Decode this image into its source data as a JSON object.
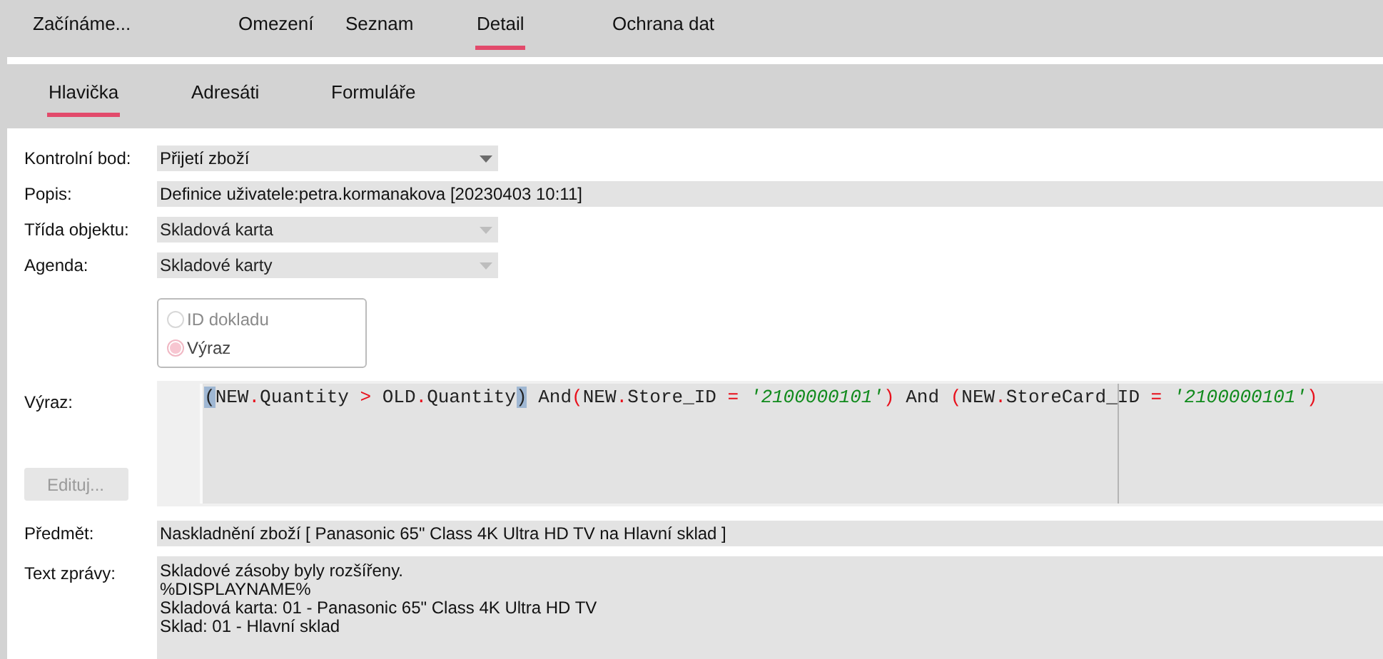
{
  "main_tabs": [
    {
      "label": "Začínáme...",
      "selected": false
    },
    {
      "label": "Omezení",
      "selected": false
    },
    {
      "label": "Seznam",
      "selected": false
    },
    {
      "label": "Detail",
      "selected": true
    },
    {
      "label": "Ochrana dat",
      "selected": false
    }
  ],
  "sub_tabs": [
    {
      "label": "Hlavička",
      "selected": true
    },
    {
      "label": "Adresáti",
      "selected": false
    },
    {
      "label": "Formuláře",
      "selected": false
    }
  ],
  "fields": [
    {
      "kind": "dropdown",
      "label": "Kontrolní bod:",
      "value": "Přijetí zboží",
      "disabled": false
    },
    {
      "kind": "text",
      "label": "Popis:",
      "value": "Definice uživatele:petra.kormanakova [20230403 10:11]"
    },
    {
      "kind": "dropdown",
      "label": "Třída objektu:",
      "value": "Skladová karta",
      "disabled": true
    },
    {
      "kind": "dropdown",
      "label": "Agenda:",
      "value": "Skladové karty",
      "disabled": true
    }
  ],
  "radios": [
    {
      "label": "ID dokladu",
      "selected": false
    },
    {
      "label": "Výraz",
      "selected": true
    }
  ],
  "expression": {
    "label": "Výraz:",
    "tokens": [
      {
        "kind": "match",
        "text": "("
      },
      {
        "kind": "plain",
        "text": "NEW"
      },
      {
        "kind": "op",
        "text": "."
      },
      {
        "kind": "plain",
        "text": "Quantity"
      },
      {
        "kind": "op",
        "text": " > "
      },
      {
        "kind": "plain",
        "text": "OLD"
      },
      {
        "kind": "op",
        "text": "."
      },
      {
        "kind": "plain",
        "text": "Quantity"
      },
      {
        "kind": "match",
        "text": ")"
      },
      {
        "kind": "plain",
        "text": " And"
      },
      {
        "kind": "op",
        "text": "("
      },
      {
        "kind": "plain",
        "text": "NEW"
      },
      {
        "kind": "op",
        "text": "."
      },
      {
        "kind": "plain",
        "text": "Store_ID"
      },
      {
        "kind": "op",
        "text": " = "
      },
      {
        "kind": "string",
        "text": "'2100000101'"
      },
      {
        "kind": "op",
        "text": ")"
      },
      {
        "kind": "plain",
        "text": " And "
      },
      {
        "kind": "op",
        "text": "("
      },
      {
        "kind": "plain",
        "text": "NEW"
      },
      {
        "kind": "op",
        "text": "."
      },
      {
        "kind": "plain",
        "text": "StoreCard_ID"
      },
      {
        "kind": "op",
        "text": " = "
      },
      {
        "kind": "string",
        "text": "'2100000101'"
      },
      {
        "kind": "op",
        "text": ")"
      }
    ],
    "edit_button": {
      "label": "Edituj...",
      "disabled": true
    }
  },
  "subject": {
    "label": "Předmět:",
    "value": "Naskladnění zboží [ Panasonic 65\" Class 4K Ultra HD TV na Hlavní sklad ]"
  },
  "message": {
    "label": "Text zprávy:",
    "lines": [
      "Skladové zásoby byly rozšířeny.",
      "%DISPLAYNAME%",
      "Skladová karta: 01 - Panasonic 65\" Class 4K Ultra HD TV",
      "Sklad: 01 - Hlavní sklad"
    ]
  }
}
